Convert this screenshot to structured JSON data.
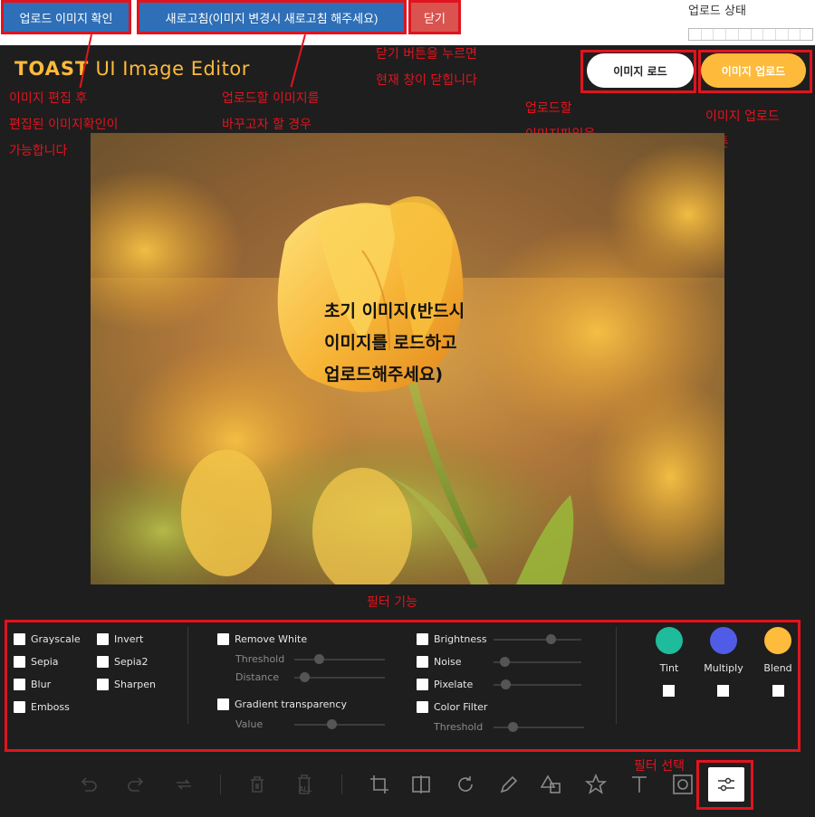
{
  "topbar": {
    "check_upload_label": "업로드 이미지 확인",
    "refresh_label": "새로고침(이미지 변경시 새로고침 해주세요)",
    "close_label": "닫기",
    "upload_status_label": "업로드 상태"
  },
  "editor": {
    "logo_brand": "TOAST",
    "logo_rest": "UI Image Editor",
    "load_image_label": "이미지 로드",
    "upload_image_label": "이미지 업로드",
    "overlay_text": "초기 이미지(반드시\n이미지를 로드하고\n업로드해주세요)"
  },
  "annotations": {
    "edit_check": "이미지 편집 후\n편집된 이미지확인이\n가능합니다",
    "refresh": "업로드할 이미지를\n바꾸고자 할 경우\n새로고침을\n선택해주세요",
    "close": "닫기 버튼을 누르면\n현재 창이 닫힙니다",
    "select_file": "업로드할\n이미지파일을\n선택",
    "upload_button": "이미지 업로드\n버튼",
    "filter_feature": "필터 기능",
    "filter_select": "필터 선택"
  },
  "filters": {
    "col1": [
      "Grayscale",
      "Sepia",
      "Blur",
      "Emboss"
    ],
    "col2": [
      "Invert",
      "Sepia2",
      "Sharpen"
    ],
    "remove_white": "Remove White",
    "threshold": "Threshold",
    "distance": "Distance",
    "gradient_transparency": "Gradient transparency",
    "value": "Value",
    "brightness": "Brightness",
    "noise": "Noise",
    "pixelate": "Pixelate",
    "color_filter": "Color Filter",
    "cf_threshold": "Threshold",
    "tint": "Tint",
    "multiply": "Multiply",
    "blend": "Blend"
  },
  "colors": {
    "brand": "#fdba3b",
    "annotation": "#e0141e",
    "button_blue": "#2e6fb7",
    "button_red": "#d9534f",
    "tint": "#1fbc9c",
    "multiply": "#515ce6",
    "blend": "#ffbb3b"
  },
  "toolbar_icons": [
    "undo-icon",
    "redo-icon",
    "reset-icon",
    "delete-icon",
    "delete-all-icon",
    "crop-icon",
    "flip-icon",
    "rotate-icon",
    "draw-icon",
    "shape-icon",
    "icon-icon",
    "text-icon",
    "mask-icon",
    "filter-icon"
  ],
  "delete_all_caption": "ALL"
}
